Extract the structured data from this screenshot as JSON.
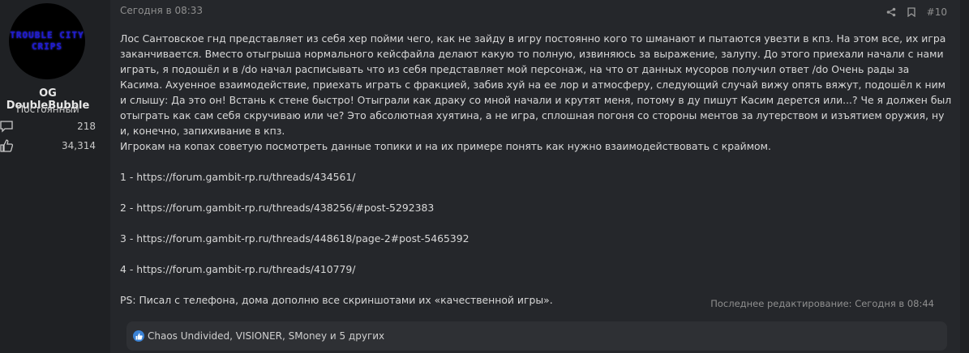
{
  "user": {
    "avatar_text_line1": "TROUBLE CITY",
    "avatar_text_line2": "CRIPS",
    "name": "OG DoubleBubble",
    "title": "Постоянный",
    "messages_count": "218",
    "reactions_count": "34,314"
  },
  "post": {
    "date": "Сегодня в 08:33",
    "number": "#10",
    "icons": [
      "share-icon",
      "bookmark-icon"
    ],
    "paragraphs": [
      "Лос Сантовское гнд представляет из себя хер пойми чего, как не зайду в игру постоянно кого то шманают и пытаются увезти в кпз. На этом все, их игра заканчивается. Вместо отыгрыша нормального кейсфайла делают какую то полную, извиняюсь за выражение, залупу. До этого приехали начали с нами играть, я подошёл и в /do начал расписывать что из себя представляет мой персонаж, на что от данных мусоров получил ответ /do Очень рады за Касима. Ахуенное взаимодействие, приехать играть с фракцией, забив хуй на ее лор и атмосферу, следующий случай вижу опять вяжут, подошёл к ним и слышу: Да это он! Встань к стене быстро! Отыграли как драку со мной начали и крутят меня, потому в ду пишут Касим дерется или...? Че я должен был отыграть как сам себя скручиваю или че? Это абсолютная хуятина, а не игра, сплошная погоня со стороны ментов за лутерством и изъятием оружия, ну и, конечно, запихивание в кпз.",
      "Игрокам на копах советую посмотреть данные топики и на их примере понять как нужно взаимодействовать с краймом."
    ],
    "links": [
      "1 - https://forum.gambit-rp.ru/threads/434561/",
      "2 - https://forum.gambit-rp.ru/threads/438256/#post-5292383",
      "3 - https://forum.gambit-rp.ru/threads/448618/page-2#post-5465392",
      "4 - https://forum.gambit-rp.ru/threads/410779/"
    ],
    "ps": "PS: Писал с телефона, дома дополню все скриншотами их «качественной игры».",
    "last_edited": "Последнее редактирование: Сегодня в 08:44",
    "reactions_text": "Chaos Undivided, VISIONER, SMoney и 5 других"
  },
  "colors": {
    "page_bg": "#1f2124",
    "post_bg": "#25272b",
    "reaction_bar_bg": "#2e3034",
    "like_blue": "#3b82d4",
    "avatar_text": "#1f1bd1"
  }
}
